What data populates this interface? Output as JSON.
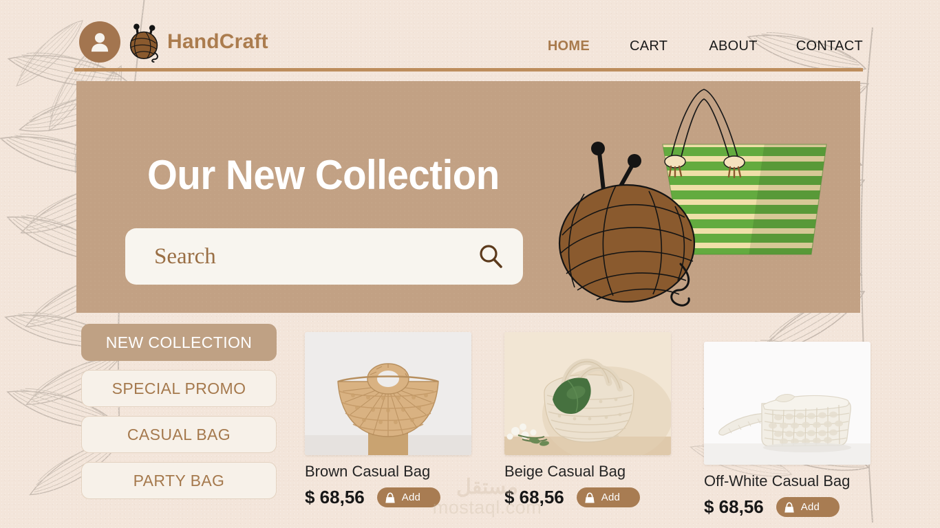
{
  "brand": {
    "name": "HandCraft",
    "avatar_icon": "user-avatar-icon",
    "logo_icon": "yarn-ball-icon",
    "color": "#ab7c4e"
  },
  "nav": {
    "items": [
      {
        "label": "HOME",
        "active": true
      },
      {
        "label": "CART",
        "active": false
      },
      {
        "label": "ABOUT",
        "active": false
      },
      {
        "label": "CONTACT",
        "active": false
      }
    ],
    "active_color": "#a87a4c",
    "inactive_color": "#1a1a1a"
  },
  "hero": {
    "title": "Our New Collection",
    "background_color": "#c2a184",
    "title_color": "#ffffff",
    "search": {
      "value": "",
      "placeholder": "Search",
      "icon": "search-icon"
    },
    "illustration": "yarn-ball-and-striped-tote-bag"
  },
  "sidebar": {
    "items": [
      {
        "label": "NEW COLLECTION",
        "active": true
      },
      {
        "label": "SPECIAL  PROMO",
        "active": false
      },
      {
        "label": "CASUAL BAG",
        "active": false
      },
      {
        "label": "PARTY BAG",
        "active": false
      }
    ],
    "active_bg": "#bfa184",
    "inactive_bg": "#f7f1e9",
    "text_color": "#a5794d"
  },
  "products": [
    {
      "title": "Brown Casual Bag",
      "price": "$ 68,56",
      "add_label": "Add",
      "add_icon": "handbag-icon",
      "image": "brown-woven-straw-tote-bag"
    },
    {
      "title": "Beige Casual Bag",
      "price": "$ 68,56",
      "add_label": "Add",
      "add_icon": "handbag-icon",
      "image": "beige-knitted-bag-with-green-leaf"
    },
    {
      "title": "Off-White Casual Bag",
      "price": "$ 68,56",
      "add_label": "Add",
      "add_icon": "handbag-icon",
      "image": "off-white-crochet-shoulder-bag"
    }
  ],
  "watermark": {
    "arabic": "مستقل",
    "latin": "mostaql.com"
  },
  "theme": {
    "page_background": "#f3e5da",
    "accent": "#bd8d5c",
    "button_brown": "#a87c52"
  }
}
